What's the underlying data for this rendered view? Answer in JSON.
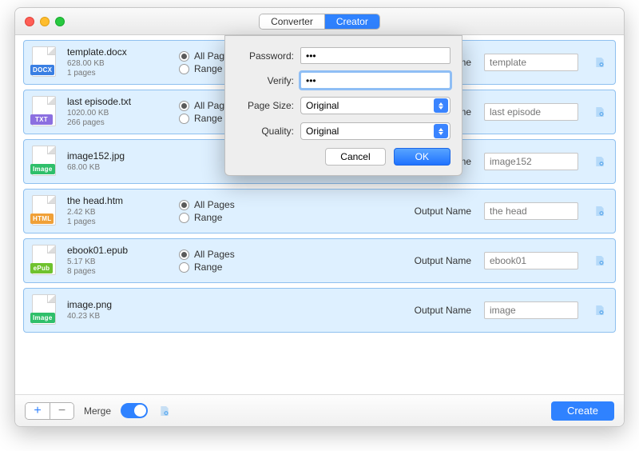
{
  "titlebar": {
    "tabs": {
      "converter": "Converter",
      "creator": "Creator"
    }
  },
  "labels": {
    "all_pages": "All Pages",
    "range": "Range",
    "output_name": "Output Name"
  },
  "files": [
    {
      "name": "template.docx",
      "size": "628.00 KB",
      "pages": "1 pages",
      "tag": "DOCX",
      "tag_color": "#3a7fe3",
      "output": "template",
      "has_pagesel": true
    },
    {
      "name": "last episode.txt",
      "size": "1020.00 KB",
      "pages": "266 pages",
      "tag": "TXT",
      "tag_color": "#8b6fe0",
      "output": "last episode",
      "has_pagesel": true
    },
    {
      "name": "image152.jpg",
      "size": "68.00 KB",
      "pages": "",
      "tag": "Image",
      "tag_color": "#2fbf6a",
      "output": "image152",
      "has_pagesel": false
    },
    {
      "name": "the head.htm",
      "size": "2.42 KB",
      "pages": "1 pages",
      "tag": "HTML",
      "tag_color": "#f0a037",
      "output": "the head",
      "has_pagesel": true
    },
    {
      "name": "ebook01.epub",
      "size": "5.17 KB",
      "pages": "8 pages",
      "tag": "ePub",
      "tag_color": "#6fc22e",
      "output": "ebook01",
      "has_pagesel": true
    },
    {
      "name": "image.png",
      "size": "40.23 KB",
      "pages": "",
      "tag": "Image",
      "tag_color": "#2fbf6a",
      "output": "image",
      "has_pagesel": false
    }
  ],
  "modal": {
    "password_label": "Password:",
    "verify_label": "Verify:",
    "pagesize_label": "Page Size:",
    "quality_label": "Quality:",
    "password_value": "•••",
    "verify_value": "•••",
    "pagesize_value": "Original",
    "quality_value": "Original",
    "cancel": "Cancel",
    "ok": "OK"
  },
  "footer": {
    "merge": "Merge",
    "create": "Create"
  }
}
